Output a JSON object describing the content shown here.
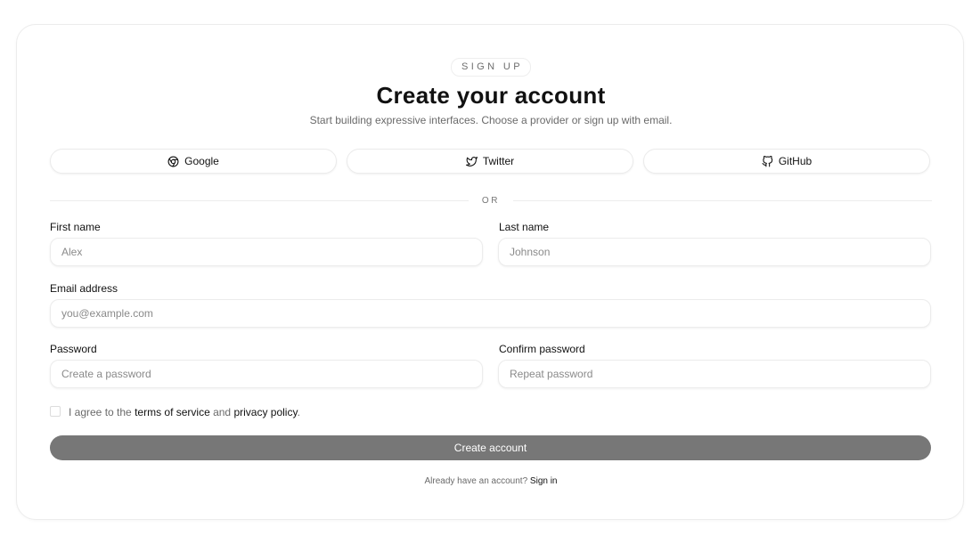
{
  "header": {
    "eyebrow": "SIGN UP",
    "title": "Create your account",
    "subtitle": "Start building expressive interfaces. Choose a provider or sign up with email."
  },
  "providers": [
    {
      "label": "Google",
      "icon": "chrome-icon"
    },
    {
      "label": "Twitter",
      "icon": "twitter-icon"
    },
    {
      "label": "GitHub",
      "icon": "github-icon"
    }
  ],
  "divider": {
    "label": "OR"
  },
  "form": {
    "first_name": {
      "label": "First name",
      "placeholder": "Alex",
      "value": ""
    },
    "last_name": {
      "label": "Last name",
      "placeholder": "Johnson",
      "value": ""
    },
    "email": {
      "label": "Email address",
      "placeholder": "you@example.com",
      "value": ""
    },
    "password": {
      "label": "Password",
      "placeholder": "Create a password",
      "value": ""
    },
    "confirm_password": {
      "label": "Confirm password",
      "placeholder": "Repeat password",
      "value": ""
    },
    "agree": {
      "checked": false,
      "prefix": "I agree to the ",
      "terms_link": "terms of service",
      "middle": " and ",
      "privacy_link": "privacy policy",
      "suffix": "."
    },
    "submit_label": "Create account"
  },
  "footer": {
    "prompt": "Already have an account? ",
    "link": "Sign in"
  },
  "colors": {
    "submit_bg": "#777777",
    "border": "#ececec",
    "text": "#111111",
    "muted": "#6a6a6a"
  }
}
